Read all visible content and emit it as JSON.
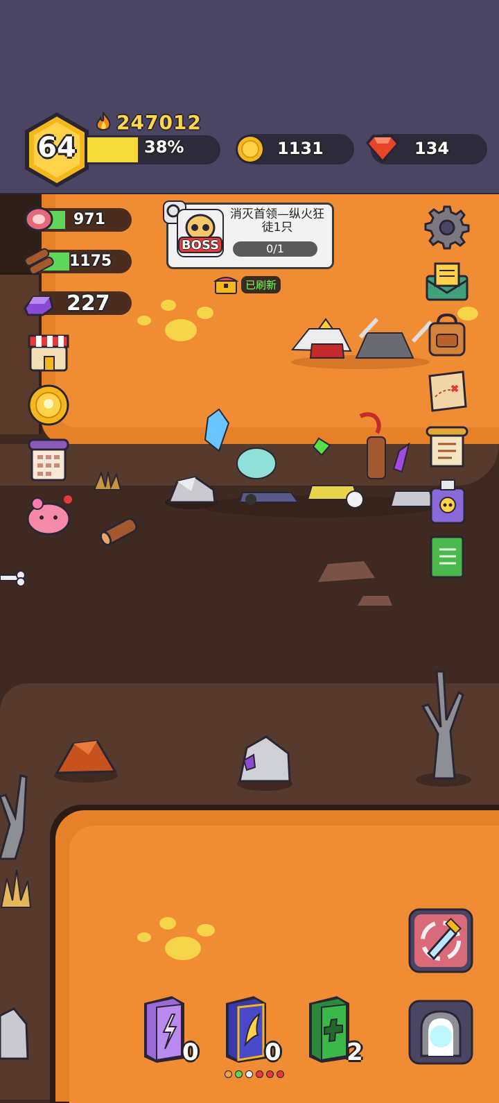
{
  "player": {
    "level": "64",
    "power": "247012",
    "exp_percent": "38%",
    "exp_fraction": 0.38
  },
  "currencies": {
    "gold": "1131",
    "gems": "134"
  },
  "resources": {
    "meat": "971",
    "wood": "1175",
    "crystal": "227"
  },
  "quest": {
    "boss_badge": "BOSS",
    "title": "消灭首领—纵火狂徒1只",
    "progress": "0/1"
  },
  "refresh": {
    "label": "已刷新"
  },
  "skill_books": [
    {
      "icon": "lightning-book-icon",
      "count": "0"
    },
    {
      "icon": "wing-book-icon",
      "count": "0"
    },
    {
      "icon": "heal-book-icon",
      "count": "2"
    }
  ],
  "colors": {
    "header_bg": "#4a4562",
    "lava": "#f08c33",
    "ground": "#3f2a22",
    "exp_fill": "#f6dc3a",
    "power_text": "#ffd84a"
  }
}
